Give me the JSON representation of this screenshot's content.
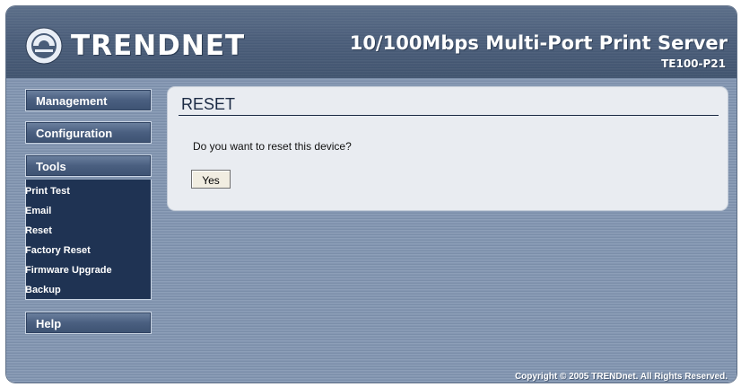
{
  "brand": {
    "logo_text": "TRENDNET"
  },
  "header": {
    "product_title": "10/100Mbps Multi-Port Print Server",
    "model": "TE100-P21"
  },
  "sidebar": {
    "management": "Management",
    "configuration": "Configuration",
    "tools": "Tools",
    "tools_items": [
      "Print Test",
      "Email",
      "Reset",
      "Factory Reset",
      "Firmware Upgrade",
      "Backup"
    ],
    "help": "Help"
  },
  "panel": {
    "title": "RESET",
    "question": "Do you want to reset this device?",
    "yes_label": "Yes"
  },
  "footer": {
    "copyright": "Copyright © 2005 TRENDnet. All Rights Reserved."
  },
  "colors": {
    "frame": "#8d9fb8",
    "header": "#4a5d79",
    "panel": "#e9ecf1",
    "submenu": "#1f3353"
  }
}
